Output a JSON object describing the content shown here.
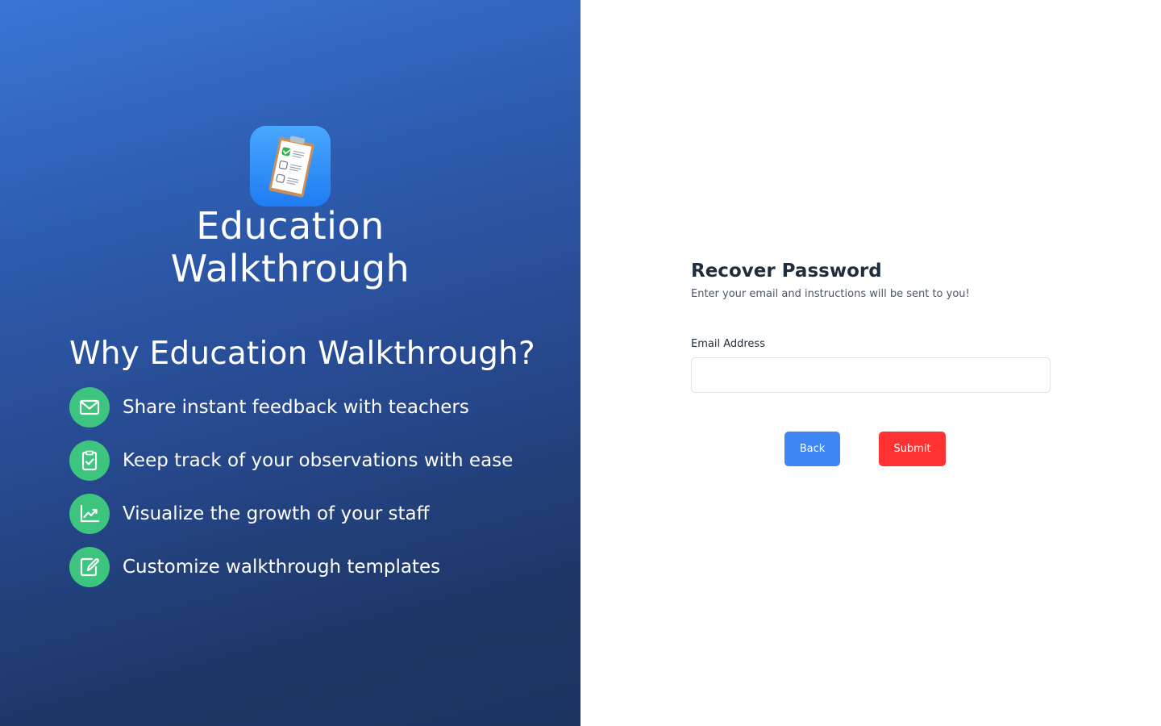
{
  "brand": {
    "logo_icon": "clipboard-checklist-icon",
    "title_line1": "Education",
    "title_line2": "Walkthrough"
  },
  "why": {
    "heading": "Why Education Walkthrough?",
    "features": [
      {
        "icon": "envelope-icon",
        "text": "Share instant feedback with teachers"
      },
      {
        "icon": "clipboard-check-icon",
        "text": "Keep track of your observations with ease"
      },
      {
        "icon": "line-chart-icon",
        "text": "Visualize the growth of your staff"
      },
      {
        "icon": "edit-document-icon",
        "text": "Customize walkthrough templates"
      }
    ]
  },
  "form": {
    "title": "Recover Password",
    "subtitle": "Enter your email and instructions will be sent to you!",
    "email_label": "Email Address",
    "email_value": "",
    "email_placeholder": "",
    "back_label": "Back",
    "submit_label": "Submit"
  },
  "colors": {
    "left_gradient_top": "#3a76d6",
    "left_gradient_bottom": "#1c3462",
    "feature_icon_bg": "#3dc47e",
    "back_button": "#3e86f5",
    "submit_button": "#ff3131",
    "logo_tile": "#2a8bf7"
  }
}
